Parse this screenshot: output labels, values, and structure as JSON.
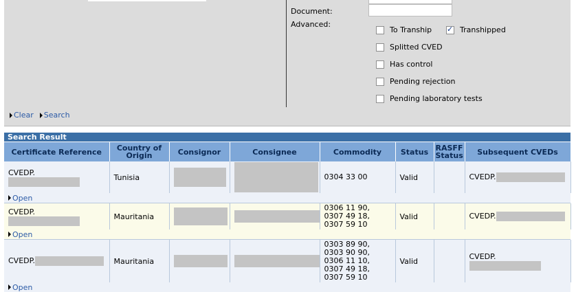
{
  "search": {
    "document_label": "Document:",
    "document_value": "",
    "advanced_label": "Advanced:",
    "options": [
      {
        "label": "To Tranship",
        "checked": false
      },
      {
        "label": "Transhipped",
        "checked": true
      },
      {
        "label": "Splitted CVED",
        "checked": false
      },
      {
        "label": "Has control",
        "checked": false
      },
      {
        "label": "Pending rejection",
        "checked": false
      },
      {
        "label": "Pending laboratory tests",
        "checked": false
      }
    ],
    "clear_label": "Clear",
    "search_label": "Search"
  },
  "result": {
    "title": "Search Result",
    "columns": [
      "Certificate Reference",
      "Country of Origin",
      "Consignor",
      "Consignee",
      "Commodity",
      "Status",
      "RASFF Status",
      "Subsequent CVEDs"
    ],
    "rows": [
      {
        "ref_prefix": "CVEDP.",
        "country": "Tunisia",
        "commodity": "0304 33 00",
        "status": "Valid",
        "subsequent_prefix": "CVEDP."
      },
      {
        "ref_prefix": "CVEDP.",
        "country": "Mauritania",
        "commodity": "0306 11 90,\n0307 49 18,\n0307 59 10",
        "status": "Valid",
        "subsequent_prefix": "CVEDP."
      },
      {
        "ref_prefix": "CVEDP.",
        "country": "Mauritania",
        "commodity": "0303 89 90,\n0303 90 90,\n0306 11 10,\n0307 49 18,\n0307 59 10",
        "status": "Valid",
        "subsequent_prefix": "CVEDP."
      }
    ],
    "open_label": "Open"
  }
}
